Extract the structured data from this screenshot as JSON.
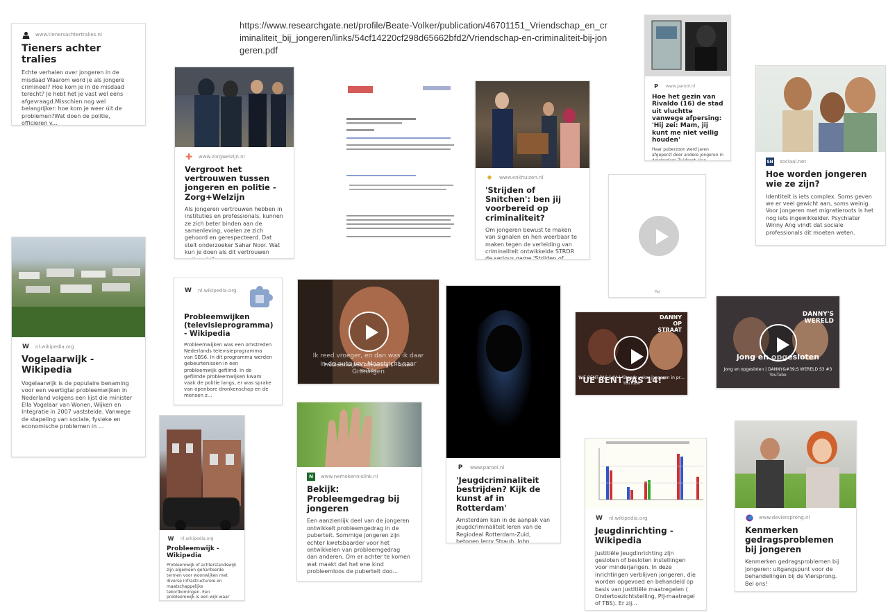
{
  "url_text": "https://www.researchgate.net/profile/Beate-Volker/publication/46701151_Vriendschap_en_criminaliteit_bij_jongeren/links/54cf14220cf298d65662bfd2/Vriendschap-en-criminaliteit-bij-jongeren.pdf",
  "cards": {
    "tieners": {
      "source": "www.tienersachtertralies.nl",
      "title": "Tieners achter tralies",
      "desc": "Echte verhalen over jongeren in de misdaad Waarom word je als jongere crimineel? Hoe kom je in de misdaad terecht? Je hebt het je vast wel eens afgevraagd.Misschien nog wel belangrijker: hoe kom je weer úit de problemen?Wat doen de politie, officieren v..."
    },
    "vogelaarwijk": {
      "source": "nl.wikipedia.org",
      "title": "Vogelaarwijk - Wikipedia",
      "desc": "Vogelaarwijk is de populaire benaming voor een veertigtal probleemwijken in Nederland volgens een lijst die minister Ella Vogelaar van Wonen, Wijken en Integratie in 2007 vaststelde. Vanwege de stapeling van sociale, fysieke en economische problemen in ..."
    },
    "vertrouwen": {
      "source": "www.zorgwelzijn.nl",
      "title": "Vergroot het vertrouwen tussen jongeren en politie - Zorg+Welzijn",
      "desc": "Als jongeren vertrouwen hebben in instituties en professionals, kunnen ze zich beter binden aan de samenleving, voelen ze zich gehoord en gerespecteerd. Dat stelt onderzoeker Sahar Noor. Wat kun je doen als dit vertrouwen ontbreekt?"
    },
    "probleemwijken_tv": {
      "source": "nl.wikipedia.org",
      "title": "Probleemwijken (televisieprogramma) - Wikipedia",
      "desc": "Probleemwijken was een omstreden Nederlands televisieprogramma van SBS6. In dit programma werden gebeurtenissen in een probleemwijk gefilmd. In de gefilmde probleemwijken kwam vaak de politie langs, er was sprake van openbare dronkenschap en de mensen z..."
    },
    "probleemwijk": {
      "source": "nl.wikipedia.org",
      "title": "Probleemwijk - Wikipedia",
      "desc": "Probleemwijk of achterstandswijk zijn algemeen gehanteerde termen voor woonwijken met diverse infrastructurele en maatschappelijke tekortkomingen. Een probleemwijk is een wijk waar zich meerdere problemen tegelijk voordoen: werkloosheid, (nachtelijke) g..."
    },
    "snitchen": {
      "source": "www.enkhuizen.nl",
      "title": "'Strijden of Snitchen': ben jij voorbereid op criminaliteit?",
      "desc": "Om jongeren bewust te maken van signalen en hen weerbaar te maken tegen de verleiding van criminaliteit ontwikkelde STRDR de serious game 'Strijden of Snitchen'. Het spel maakt op praktische..."
    },
    "probleemgedrag": {
      "source": "www.nemokennislink.nl",
      "title": "Bekijk: Probleemgedrag bij jongeren",
      "desc": "Een aanzienlijk deel van de jongeren ontwikkelt probleemgedrag in de puberteit. Sommige jongeren zijn echter kwetsbaarder voor het ontwikkelen van probleemgedrag dan anderen. Om er achter te komen wat maakt dat het ene kind probleemloos de puberteit doo..."
    },
    "rotterdam": {
      "source": "www.parool.nl",
      "title": "'Jeugdcriminaliteit bestrijden? Kijk de kunst af in Rotterdam'",
      "desc": "Amsterdam kan in de aanpak van jeugdcriminaliteit leren van de Regiodeal Rotterdam-Zuid, betogen Jerry Straub, John Leerdam, John Autar en Gin Sanc..."
    },
    "rivaldo": {
      "source": "www.parool.nl",
      "title": "Hoe het gezin van Rivaldo (16) de stad uit vluchtte vanwege afpersing: 'Hij zei: Mam, jij kunt me niet veilig houden'",
      "desc": "Haar puberzoon werd jaren afgeperst door andere jongeren in Amsterdam-Zuidoost. Van scholen wisselen hielp niet, hulpverleners bleken machteloos. In..."
    },
    "jeugdinrichting": {
      "source": "nl.wikipedia.org",
      "title": "Jeugdinrichting - Wikipedia",
      "desc": "Justitiële Jeugdinrichting zijn gesloten of besloten instellingen voor minderjarigen. In deze inrichtingen verblijven jongeren, die worden opgevoed en behandeld op basis van justitiële maatregelen ( Ondertoezichtstelling, PIJ-maatregel of TBS). Er zij..."
    },
    "sociaal": {
      "source": "sociaal.net",
      "title": "Hoe worden jongeren wie ze zijn?",
      "desc": "Identiteit is iets complex. Soms geven we er veel gewicht aan, soms weinig. Voor jongeren met migratieroots is het nog iets ingewikkelder. Psychiater Winny Ang vindt dat sociale professionals dit moeten weten."
    },
    "kenmerken": {
      "source": "www.deviersprong.nl",
      "title": "Kenmerken gedragsproblemen bij jongeren",
      "desc": "Kenmerken gedragsproblemen bij jongeren: uitgangspunt voor de behandelingen bij de Viersprong. Bel ons!"
    }
  },
  "videos": {
    "v1": {
      "caption": "Probleemwijken Aflevering 1 - Assen",
      "sub": "YouTube",
      "overlay": "Ik reed vroeger, en dan was ik daar in de auto van Maastricht naar Groningen"
    },
    "v2": {
      "caption": "\"UE BENT PAS 14!\" | 'Steeds vaker jongeren in problemen geraakt' | DA...",
      "sub": "YouTube",
      "tag": "DANNY OP STRAAT",
      "overlay": "\"UE BENT PAS 14!\""
    },
    "v3": {
      "caption": "Jong en opgesloten | DANNY&#39;S WERELD S3 #3",
      "sub": "YouTube",
      "tag": "DANNY'S WERELD",
      "overlay": "jong en opgesloten"
    },
    "v4": {
      "caption": "Pal",
      "sub": ""
    }
  },
  "colors": {
    "border": "#dcdcdc",
    "title": "#222222",
    "desc": "#444444",
    "source": "#888888"
  }
}
